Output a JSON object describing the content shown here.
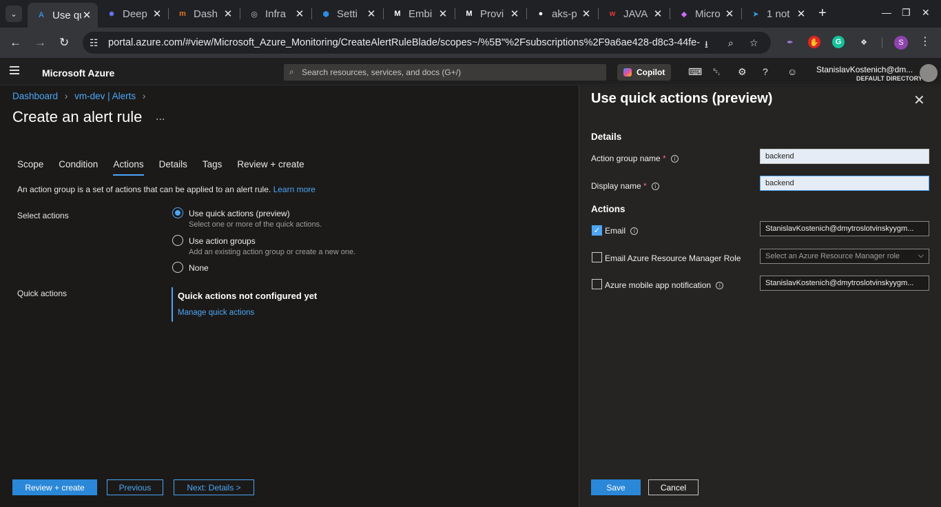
{
  "browser": {
    "tabs": [
      {
        "title": "Use qu",
        "favicon": "A",
        "color": "#3b8de0",
        "active": true
      },
      {
        "title": "Deep",
        "favicon": "✸",
        "color": "#6a7cff"
      },
      {
        "title": "Dash",
        "favicon": "m",
        "color": "#e0762b"
      },
      {
        "title": "Infra",
        "favicon": "◎",
        "color": "#bdc1c6"
      },
      {
        "title": "Setti",
        "favicon": "⬢",
        "color": "#2f8ae0"
      },
      {
        "title": "Embi",
        "favicon": "M",
        "color": "#ffffff"
      },
      {
        "title": "Provi",
        "favicon": "M",
        "color": "#ffffff"
      },
      {
        "title": "aks-p",
        "favicon": "●",
        "color": "#ffffff"
      },
      {
        "title": "JAVA",
        "favicon": "w",
        "color": "#e53935"
      },
      {
        "title": "Micro",
        "favicon": "◆",
        "color": "#c86bfa"
      },
      {
        "title": "1 not",
        "favicon": "➤",
        "color": "#2ea6e0"
      }
    ],
    "url": "portal.azure.com/#view/Microsoft_Azure_Monitoring/CreateAlertRuleBlade/scopes~/%5B\"%2Fsubscriptions%2F9a6ae428-d8c3-44fe-...",
    "profile_initial": "S"
  },
  "azure": {
    "brand": "Microsoft Azure",
    "search_placeholder": "Search resources, services, and docs (G+/)",
    "copilot": "Copilot",
    "user_name": "StanislavKostenich@dm...",
    "user_directory": "DEFAULT DIRECTORY"
  },
  "main": {
    "breadcrumb": [
      "Dashboard",
      "vm-dev | Alerts"
    ],
    "title": "Create an alert rule",
    "more": "...",
    "tabs": [
      "Scope",
      "Condition",
      "Actions",
      "Details",
      "Tags",
      "Review + create"
    ],
    "selected_tab": "Actions",
    "intro_text": "An action group is a set of actions that can be applied to an alert rule.",
    "learn_more": "Learn more",
    "select_actions_label": "Select actions",
    "options": [
      {
        "label": "Use quick actions (preview)",
        "hint": "Select one or more of the quick actions.",
        "selected": true
      },
      {
        "label": "Use action groups",
        "hint": "Add an existing action group or create a new one.",
        "selected": false
      },
      {
        "label": "None",
        "hint": "",
        "selected": false
      }
    ],
    "quick_actions_label": "Quick actions",
    "quick_actions_title": "Quick actions not configured yet",
    "manage_quick_actions": "Manage quick actions",
    "buttons": {
      "review_create": "Review + create",
      "previous": "Previous",
      "next": "Next: Details >"
    }
  },
  "pane": {
    "title": "Use quick actions (preview)",
    "details_heading": "Details",
    "action_group_name_label": "Action group name",
    "action_group_name_value": "backend",
    "display_name_label": "Display name",
    "display_name_value": "backend",
    "actions_heading": "Actions",
    "email_label": "Email",
    "email_checked": true,
    "email_value": "StanislavKostenich@dmytroslotvinskyygm...",
    "arm_role_label": "Email Azure Resource Manager Role",
    "arm_role_checked": false,
    "arm_role_placeholder": "Select an Azure Resource Manager role",
    "mobile_label": "Azure mobile app notification",
    "mobile_checked": false,
    "mobile_value": "StanislavKostenich@dmytroslotvinskyygm...",
    "save": "Save",
    "cancel": "Cancel"
  }
}
